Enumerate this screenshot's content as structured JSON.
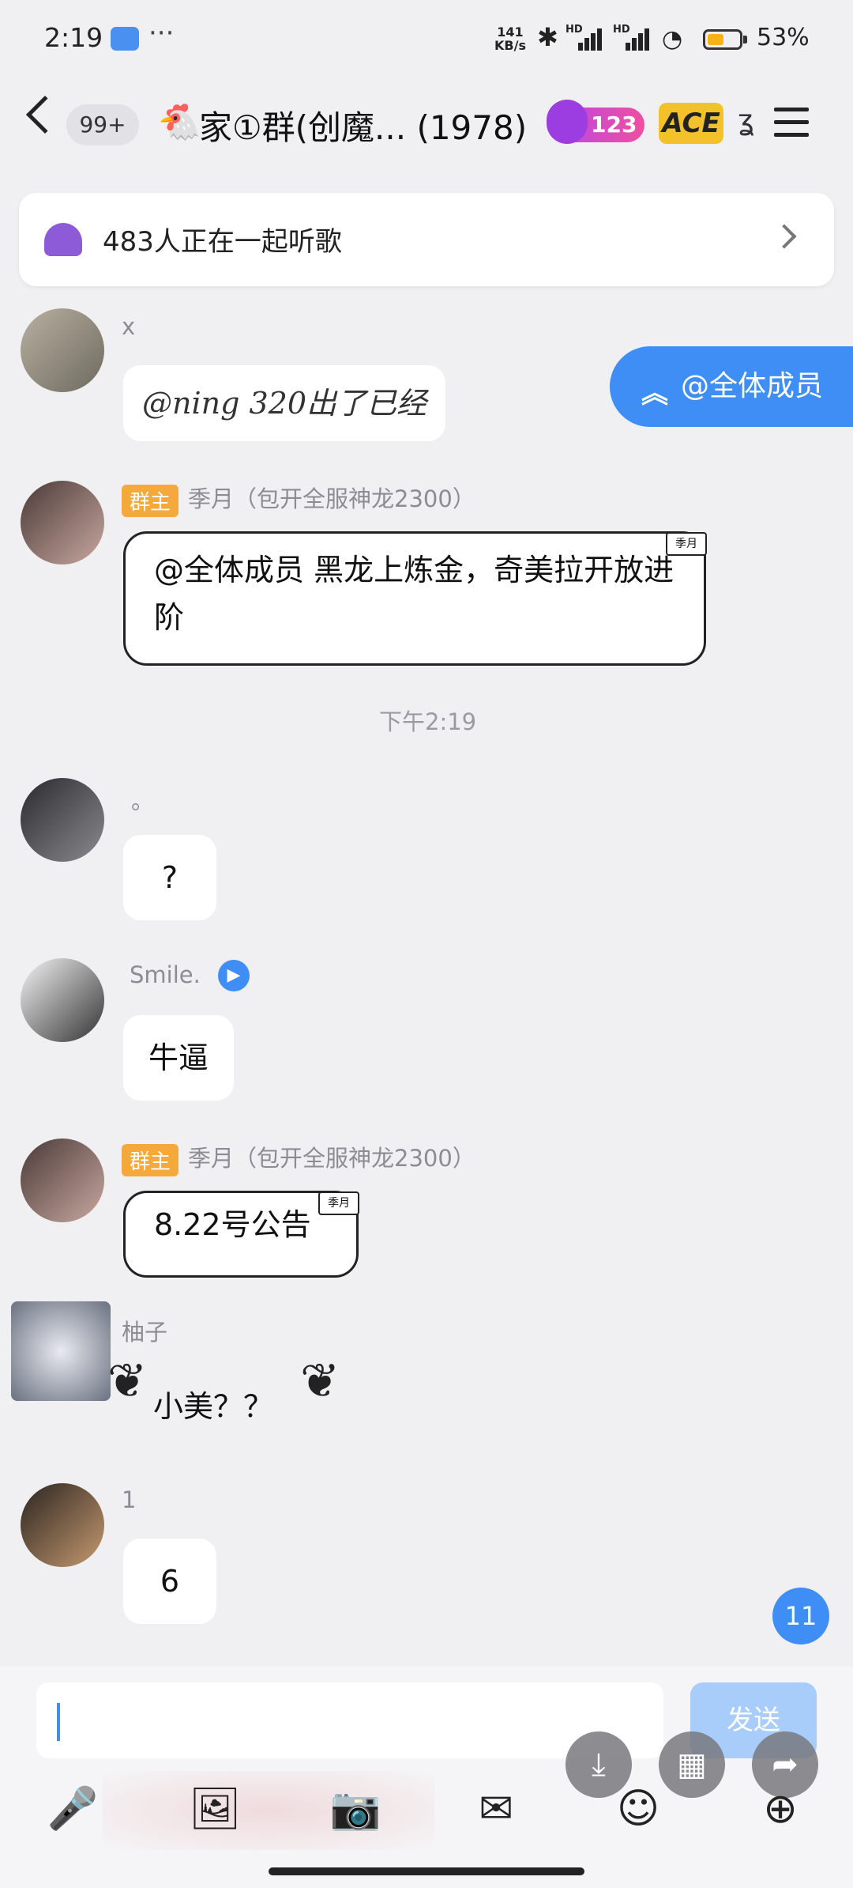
{
  "status_bar": {
    "time": "2:19",
    "app_icon": "gallery-icon",
    "more": "···",
    "net_speed_value": "141",
    "net_speed_unit": "KB/s",
    "bluetooth_icon": "bluetooth-icon",
    "hd_label": "HD",
    "wifi_icon": "wifi-icon",
    "battery_percent": "53%",
    "battery_level": 0.53,
    "battery_color": "#f5b316"
  },
  "header": {
    "unread_badge": "99+",
    "title_icon": "chicken-icon",
    "title": "家①群(创魔... (1978)",
    "level": "123",
    "ace_badge": "ACE"
  },
  "listening_bar": {
    "text": "483人正在一起听歌"
  },
  "messages": [
    {
      "name": "x",
      "text": "@ning 320出了已经"
    },
    {
      "owner_tag": "群主",
      "name": "季月（包开全服神龙2300）",
      "text": "@全体成员 黑龙上炼金，奇美拉开放进阶",
      "bubble_tag": "季月"
    },
    {
      "name": "。",
      "text": "?"
    },
    {
      "name": "Smile.",
      "text": "牛逼"
    },
    {
      "owner_tag": "群主",
      "name": "季月（包开全服神龙2300）",
      "text": "8.22号公告",
      "bubble_tag": "季月"
    },
    {
      "name": "柚子",
      "text": "小美？？"
    },
    {
      "name": "1",
      "text": "6"
    }
  ],
  "timestamp": "下午2:19",
  "mention_button": "@全体成员",
  "new_message_count": "11",
  "input": {
    "send_label": "发送"
  },
  "colors": {
    "accent": "#3e8ef5",
    "owner_tag": "#f6a93b",
    "background": "#f0f0f2"
  }
}
